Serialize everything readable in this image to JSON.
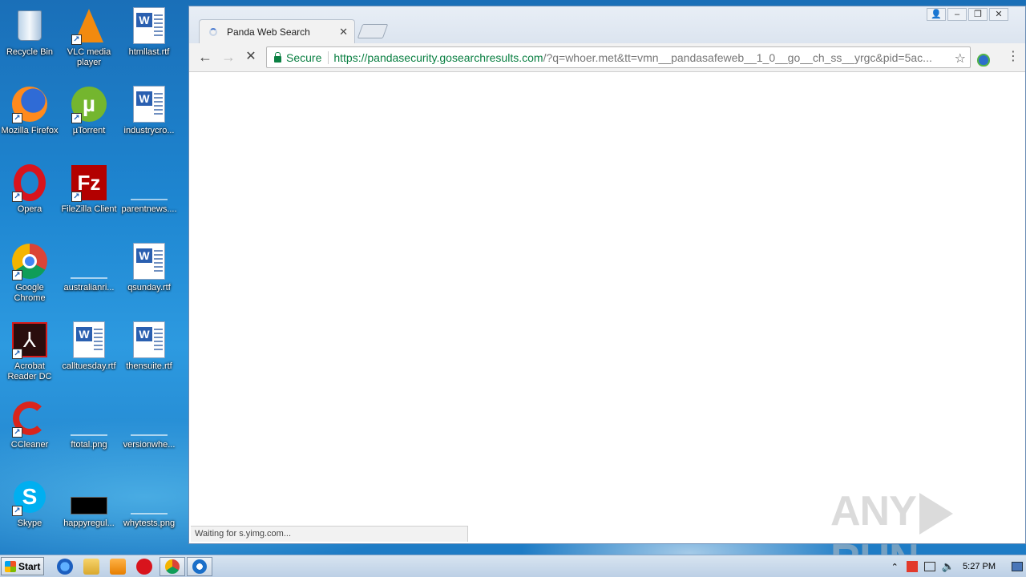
{
  "desktop": {
    "icons": [
      {
        "label": "Recycle Bin",
        "icon": "recycle-bin-icon"
      },
      {
        "label": "VLC media player",
        "icon": "vlc-icon"
      },
      {
        "label": "htmllast.rtf",
        "icon": "word-doc-icon"
      },
      {
        "label": "Mozilla Firefox",
        "icon": "firefox-icon"
      },
      {
        "label": "µTorrent",
        "icon": "utorrent-icon"
      },
      {
        "label": "industrycro...",
        "icon": "word-doc-icon"
      },
      {
        "label": "Opera",
        "icon": "opera-icon"
      },
      {
        "label": "FileZilla Client",
        "icon": "filezilla-icon"
      },
      {
        "label": "parentnews....",
        "icon": "image-thumb-icon"
      },
      {
        "label": "Google Chrome",
        "icon": "chrome-icon"
      },
      {
        "label": "australianri...",
        "icon": "image-thumb-icon"
      },
      {
        "label": "qsunday.rtf",
        "icon": "word-doc-icon"
      },
      {
        "label": "Acrobat Reader DC",
        "icon": "acrobat-icon"
      },
      {
        "label": "calltuesday.rtf",
        "icon": "word-doc-icon"
      },
      {
        "label": "thensuite.rtf",
        "icon": "word-doc-icon"
      },
      {
        "label": "CCleaner",
        "icon": "ccleaner-icon"
      },
      {
        "label": "ftotal.png",
        "icon": "image-thumb-icon"
      },
      {
        "label": "versionwhe...",
        "icon": "image-thumb-icon"
      },
      {
        "label": "Skype",
        "icon": "skype-icon"
      },
      {
        "label": "happyregul...",
        "icon": "image-thumb-icon"
      },
      {
        "label": "whytests.png",
        "icon": "image-thumb-icon"
      }
    ]
  },
  "browser": {
    "tab_title": "Panda Web Search",
    "secure_label": "Secure",
    "url_host": "https://pandasecurity.gosearchresults.com",
    "url_rest": "/?q=whoer.met&tt=vmn__pandasafeweb__1_0__go__ch_ss__yrgc&pid=5ac...",
    "status": "Waiting for s.yimg.com..."
  },
  "watermark": {
    "left": "ANY",
    "right": "RUN"
  },
  "taskbar": {
    "start_label": "Start",
    "clock": "5:27 PM"
  }
}
